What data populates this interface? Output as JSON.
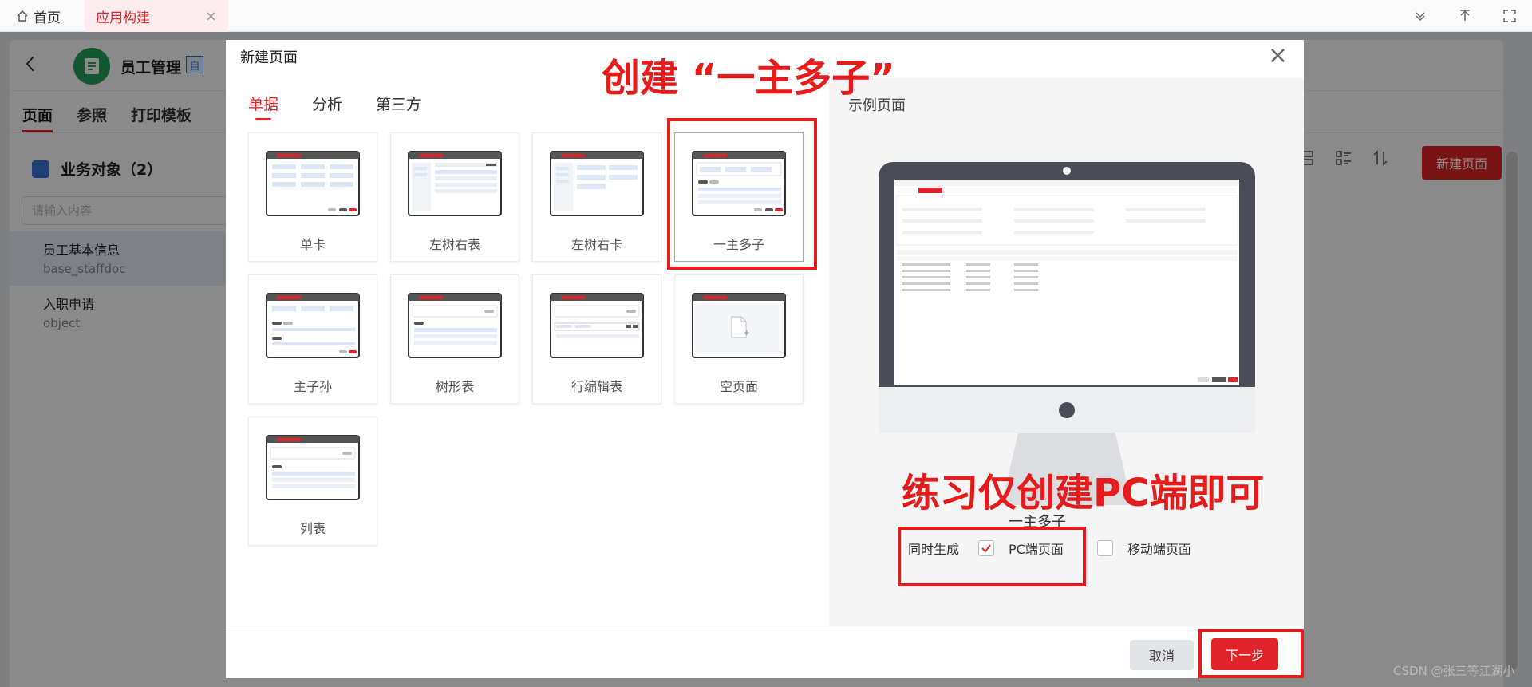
{
  "topbar": {
    "home_label": "首页",
    "active_tab_label": "应用构建",
    "close_glyph": "×"
  },
  "app": {
    "title": "员工管理",
    "badge": "自",
    "subtabs": [
      "页面",
      "参照",
      "打印模板"
    ],
    "biz_object_title": "业务对象（2）",
    "search_placeholder": "请输入内容",
    "objects": [
      {
        "name": "员工基本信息",
        "code": "base_staffdoc"
      },
      {
        "name": "入职申请",
        "code": "object"
      }
    ],
    "new_page_label": "新建页面"
  },
  "modal": {
    "title": "新建页面",
    "close_glyph": "×",
    "tabs": [
      "单据",
      "分析",
      "第三方"
    ],
    "active_tab": "单据",
    "templates": [
      "单卡",
      "左树右表",
      "左树右卡",
      "一主多子",
      "主子孙",
      "树形表",
      "行编辑表",
      "空页面",
      "列表"
    ],
    "selected_template": "一主多子",
    "example_label": "示例页面",
    "example_caption": "一主多子",
    "gen_label": "同时生成",
    "pc_label": "PC端页面",
    "pc_checked": true,
    "mobile_label": "移动端页面",
    "mobile_checked": false,
    "cancel_label": "取消",
    "next_label": "下一步"
  },
  "annotations": {
    "top_note": "创建 “一主多子”",
    "side_note": "练习仅创建PC端即可",
    "color": "#e61c1c"
  },
  "watermark": "CSDN @张三等江湖小"
}
